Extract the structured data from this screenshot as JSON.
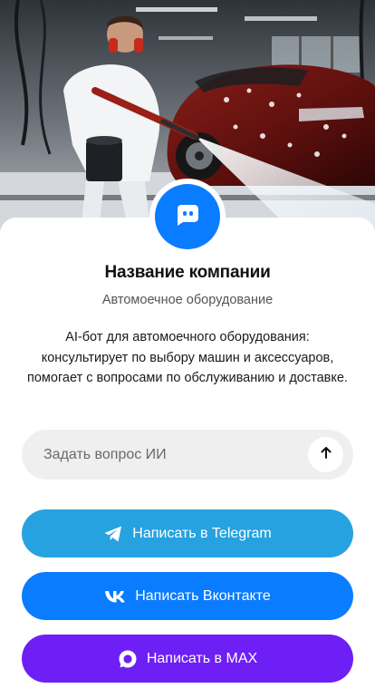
{
  "company": {
    "name": "Название компании",
    "subtitle": "Автомоечное оборудование",
    "description": "AI-бот для автомоечного оборудования: консультирует по выбору машин и аксессуаров, помогает с вопросами по обслуживанию и доставке."
  },
  "ask": {
    "placeholder": "Задать вопрос ИИ"
  },
  "buttons": {
    "telegram": "Написать в Telegram",
    "vk": "Написать Вконтакте",
    "max": "Написать в MAX"
  },
  "colors": {
    "accent_blue": "#0a7cff",
    "telegram": "#27a2e0",
    "max": "#6e1ff5",
    "input_bg": "#efefef"
  },
  "icons": {
    "avatar": "chat-bot-icon",
    "send": "arrow-up-icon",
    "telegram": "telegram-icon",
    "vk": "vk-icon",
    "max": "max-icon"
  }
}
